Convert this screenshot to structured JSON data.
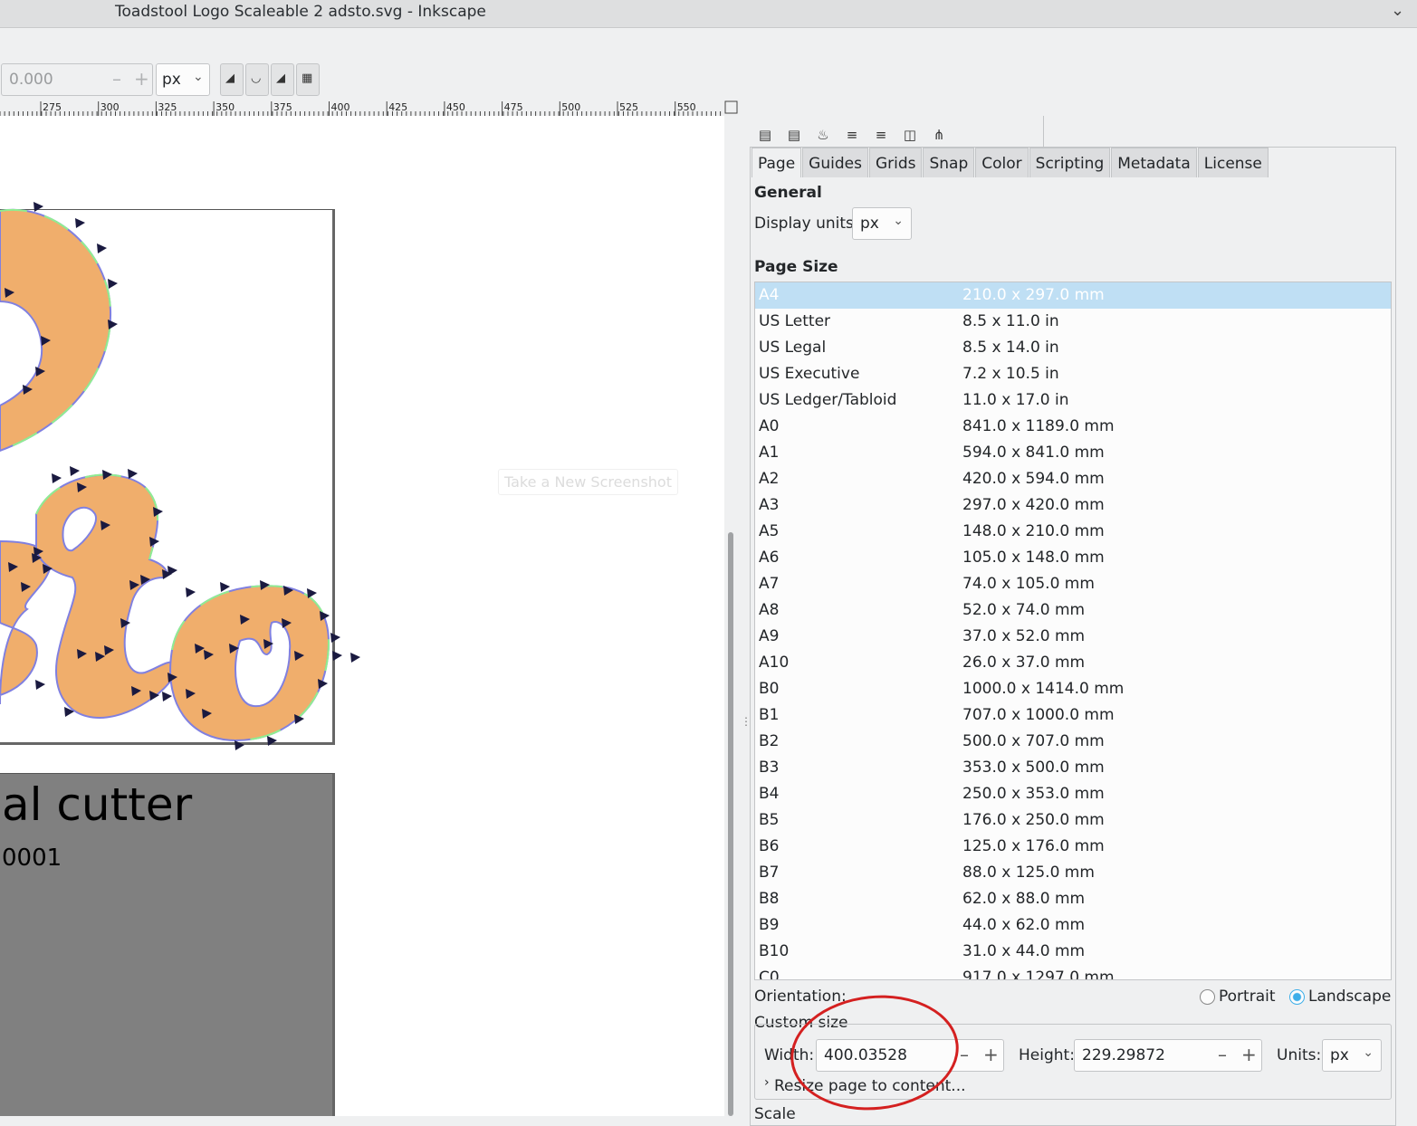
{
  "window": {
    "title": "Toadstool Logo Scaleable 2 adsto.svg - Inkscape"
  },
  "toolbar": {
    "value": "0.000",
    "minus": "–",
    "plus": "+",
    "unit": "px"
  },
  "ruler": {
    "ticks": [
      "275",
      "300",
      "325",
      "350",
      "375",
      "400",
      "425",
      "450",
      "475",
      "500",
      "525",
      "550"
    ]
  },
  "canvas": {
    "box_text_1": "al cutter",
    "box_text_2": "0001",
    "screenshot_button": "Take a New Screenshot",
    "colors": {
      "fill": "#f0ae6c",
      "stroke_a": "#8080e0",
      "stroke_b": "#90ee90",
      "nodes": "#1a1a40"
    }
  },
  "dock": {
    "tabs": [
      "Page",
      "Guides",
      "Grids",
      "Snap",
      "Color",
      "Scripting",
      "Metadata",
      "License"
    ],
    "active_tab": "Page",
    "general_header": "General",
    "display_units_label": "Display units:",
    "display_units_value": "px",
    "page_size_header": "Page Size",
    "page_sizes": [
      {
        "name": "A4",
        "dims": "210.0 x 297.0 mm",
        "selected": true
      },
      {
        "name": "US Letter",
        "dims": "8.5 x 11.0 in"
      },
      {
        "name": "US Legal",
        "dims": "8.5 x 14.0 in"
      },
      {
        "name": "US Executive",
        "dims": "7.2 x 10.5 in"
      },
      {
        "name": "US Ledger/Tabloid",
        "dims": "11.0 x 17.0 in"
      },
      {
        "name": "A0",
        "dims": "841.0 x 1189.0 mm"
      },
      {
        "name": "A1",
        "dims": "594.0 x 841.0 mm"
      },
      {
        "name": "A2",
        "dims": "420.0 x 594.0 mm"
      },
      {
        "name": "A3",
        "dims": "297.0 x 420.0 mm"
      },
      {
        "name": "A5",
        "dims": "148.0 x 210.0 mm"
      },
      {
        "name": "A6",
        "dims": "105.0 x 148.0 mm"
      },
      {
        "name": "A7",
        "dims": "74.0 x 105.0 mm"
      },
      {
        "name": "A8",
        "dims": "52.0 x 74.0 mm"
      },
      {
        "name": "A9",
        "dims": "37.0 x 52.0 mm"
      },
      {
        "name": "A10",
        "dims": "26.0 x 37.0 mm"
      },
      {
        "name": "B0",
        "dims": "1000.0 x 1414.0 mm"
      },
      {
        "name": "B1",
        "dims": "707.0 x 1000.0 mm"
      },
      {
        "name": "B2",
        "dims": "500.0 x 707.0 mm"
      },
      {
        "name": "B3",
        "dims": "353.0 x 500.0 mm"
      },
      {
        "name": "B4",
        "dims": "250.0 x 353.0 mm"
      },
      {
        "name": "B5",
        "dims": "176.0 x 250.0 mm"
      },
      {
        "name": "B6",
        "dims": "125.0 x 176.0 mm"
      },
      {
        "name": "B7",
        "dims": "88.0 x 125.0 mm"
      },
      {
        "name": "B8",
        "dims": "62.0 x 88.0 mm"
      },
      {
        "name": "B9",
        "dims": "44.0 x 62.0 mm"
      },
      {
        "name": "B10",
        "dims": "31.0 x 44.0 mm"
      },
      {
        "name": "C0",
        "dims": "917.0 x 1297.0 mm"
      }
    ],
    "orientation_label": "Orientation:",
    "portrait_label": "Portrait",
    "landscape_label": "Landscape",
    "orientation_value": "Landscape",
    "custom_size_label": "Custom size",
    "width_label": "Width:",
    "width_value": "400.03528",
    "height_label": "Height:",
    "height_value": "229.29872",
    "units_label": "Units:",
    "units_value": "px",
    "minus": "–",
    "plus": "+",
    "resize_label": "Resize page to content...",
    "scale_label": "Scale"
  }
}
